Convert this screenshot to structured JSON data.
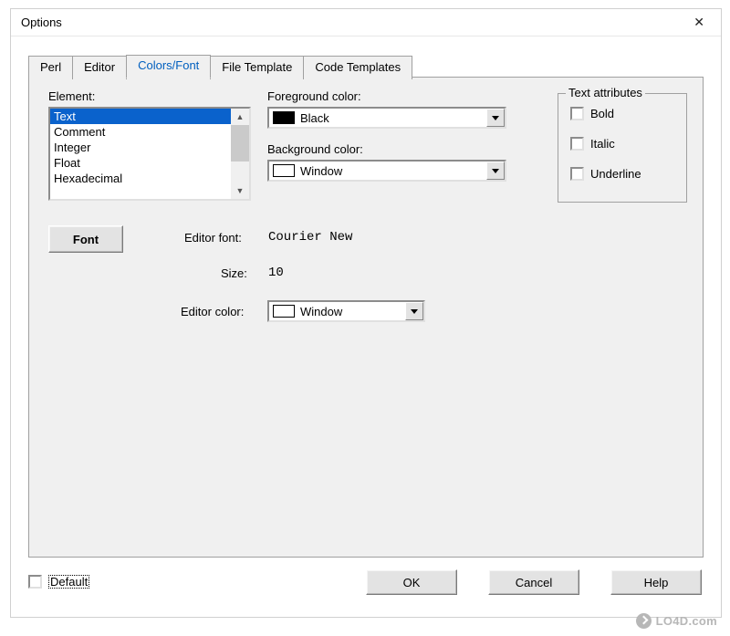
{
  "window": {
    "title": "Options"
  },
  "tabs": [
    {
      "label": "Perl"
    },
    {
      "label": "Editor"
    },
    {
      "label": "Colors/Font"
    },
    {
      "label": "File Template"
    },
    {
      "label": "Code Templates"
    }
  ],
  "labels": {
    "element": "Element:",
    "fg": "Foreground color:",
    "bg": "Background color:",
    "text_attr": "Text attributes",
    "editor_font": "Editor font:",
    "size": "Size:",
    "editor_color": "Editor color:"
  },
  "elements": [
    "Text",
    "Comment",
    "Integer",
    "Float",
    "Hexadecimal"
  ],
  "fg_combo": {
    "text": "Black",
    "swatch": "#000000"
  },
  "bg_combo": {
    "text": "Window",
    "swatch": "#ffffff"
  },
  "editor_color_combo": {
    "text": "Window",
    "swatch": "#ffffff"
  },
  "attrs": {
    "bold": "Bold",
    "italic": "Italic",
    "underline": "Underline"
  },
  "font_button": "Font",
  "editor_font_value": "Courier New",
  "size_value": "10",
  "default_label": "Default",
  "buttons": {
    "ok": "OK",
    "cancel": "Cancel",
    "help": "Help"
  },
  "watermark": "LO4D.com"
}
